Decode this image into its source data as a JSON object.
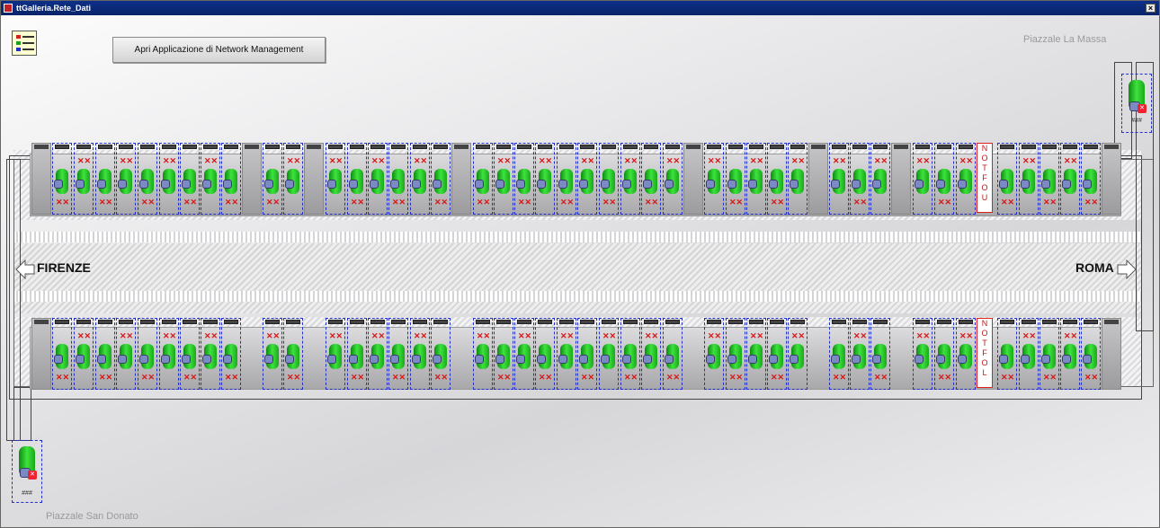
{
  "window": {
    "title": "ttGalleria.Rete_Dati",
    "close_glyph": "×"
  },
  "toolbar": {
    "open_app_label": "Apri Applicazione di Network Management"
  },
  "places": {
    "top_right": "Piazzale La Massa",
    "bottom_left": "Piazzale San Donato"
  },
  "directions": {
    "left": "FIRENZE",
    "right": "ROMA"
  },
  "servers": {
    "top_right_label": "###",
    "bottom_left_label": "###"
  },
  "panels": {
    "top": {
      "letters": [
        "N",
        "O",
        "T",
        "F",
        "O",
        "U"
      ]
    },
    "bottom": {
      "letters": [
        "N",
        "O",
        "T",
        "F",
        "O",
        "L"
      ]
    }
  },
  "icons": {
    "menu": "list-menu-icon",
    "device": "network-switch-icon",
    "fault": "red-x-icon",
    "server": "server-icon"
  },
  "colors": {
    "titlebar": "#0a246a",
    "cabinet_border": "#2230c8",
    "device_ok": "#2ec62e",
    "fault": "#d81818",
    "notfo_border": "#e02020"
  }
}
